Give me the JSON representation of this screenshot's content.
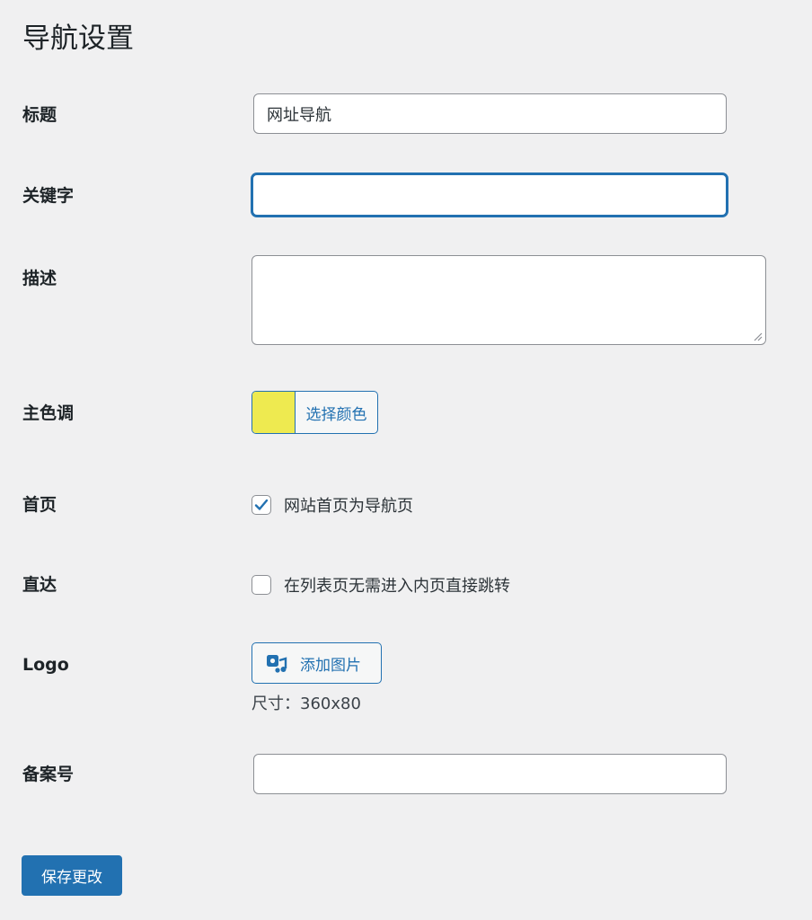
{
  "page": {
    "title": "导航设置"
  },
  "fields": {
    "title": {
      "label": "标题",
      "value": "网址导航"
    },
    "keywords": {
      "label": "关键字",
      "value": ""
    },
    "description": {
      "label": "描述",
      "value": ""
    },
    "primary_color": {
      "label": "主色调",
      "button_label": "选择颜色",
      "color": "#eeea50"
    },
    "homepage": {
      "label": "首页",
      "checkbox_label": "网站首页为导航页",
      "checked": true
    },
    "direct": {
      "label": "直达",
      "checkbox_label": "在列表页无需进入内页直接跳转",
      "checked": false
    },
    "logo": {
      "label": "Logo",
      "button_label": "添加图片",
      "icon": "add-media-icon",
      "size_note": "尺寸：360x80"
    },
    "icp": {
      "label": "备案号",
      "value": ""
    }
  },
  "actions": {
    "save_label": "保存更改"
  },
  "colors": {
    "accent": "#2271b1",
    "background": "#f0f0f1",
    "text": "#1d2327"
  }
}
